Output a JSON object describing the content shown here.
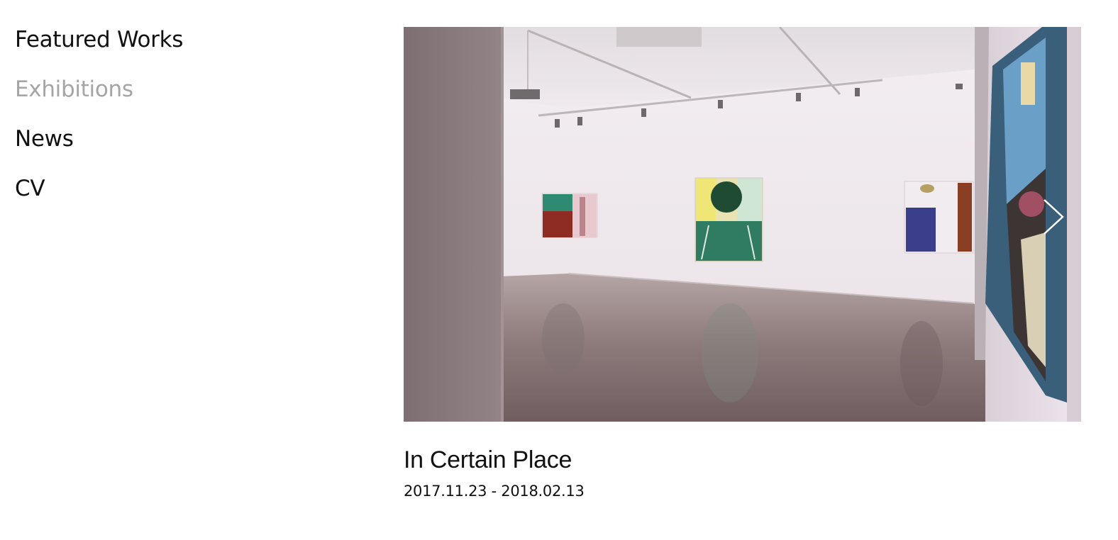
{
  "nav": {
    "items": [
      {
        "label": "Featured Works",
        "active": false
      },
      {
        "label": "Exhibitions",
        "active": true
      },
      {
        "label": "News",
        "active": false
      },
      {
        "label": "CV",
        "active": false
      }
    ]
  },
  "slider": {
    "next_icon": "chevron-right-icon"
  },
  "exhibition": {
    "title": "In Certain Place",
    "dates": "2017.11.23 - 2018.02.13"
  },
  "colors": {
    "text": "#111111",
    "active_nav": "#a5a5a5",
    "background": "#ffffff"
  }
}
